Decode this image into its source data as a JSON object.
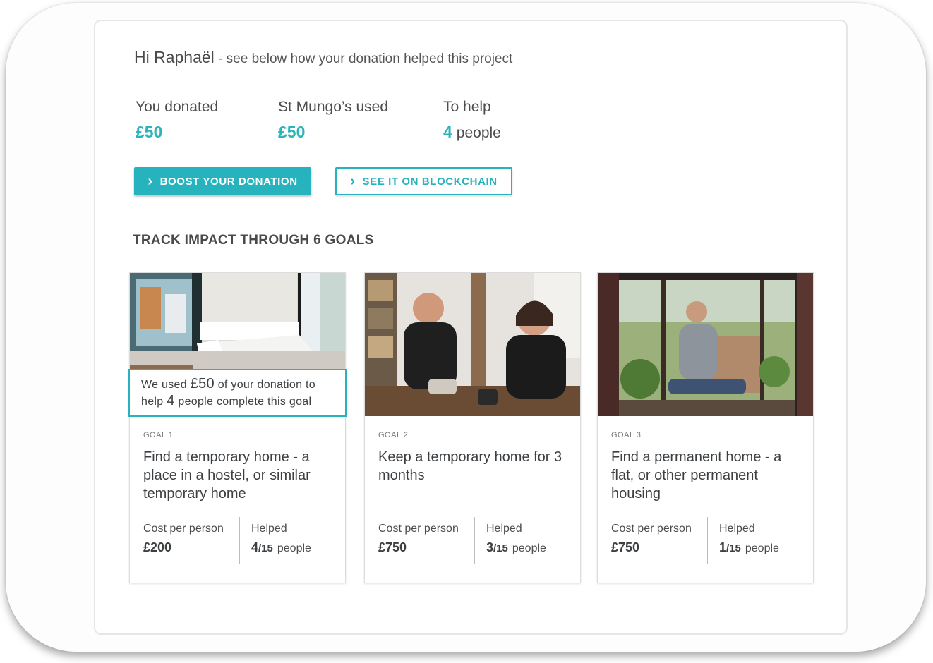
{
  "greeting": {
    "name": "Hi Raphaël",
    "message": "- see below how your donation helped this project"
  },
  "stats": {
    "donated": {
      "label": "You donated",
      "value": "£50"
    },
    "used": {
      "label": "St Mungo’s used",
      "value": "£50"
    },
    "help": {
      "label": "To help",
      "value": "4",
      "unit": "people"
    }
  },
  "buttons": {
    "boost": {
      "label": "BOOST YOUR DONATION",
      "icon": "chevron-right-icon"
    },
    "blockchain": {
      "label": "SEE IT ON BLOCKCHAIN",
      "icon": "chevron-right-icon"
    }
  },
  "section": {
    "title": "TRACK IMPACT THROUGH 6 GOALS"
  },
  "tooltip": {
    "p1": "We used",
    "amount": "£50",
    "p2": "of your donation to",
    "p3": "help",
    "count": "4",
    "p4": "people complete this goal"
  },
  "goals": [
    {
      "label": "GOAL 1",
      "title": "Find a temporary home - a place in a hostel, or similar temporary home",
      "cost_label": "Cost per person",
      "cost": "£200",
      "helped_label": "Helped",
      "helped": "4",
      "of": "/15",
      "people": "people",
      "photo": "hostel-room-photo"
    },
    {
      "label": "GOAL 2",
      "title": "Keep a temporary home for 3 months",
      "cost_label": "Cost per person",
      "cost": "£750",
      "helped_label": "Helped",
      "helped": "3",
      "of": "/15",
      "people": "people",
      "photo": "two-people-talking-photo"
    },
    {
      "label": "GOAL 3",
      "title": "Find a permanent home - a flat, or other permanent housing",
      "cost_label": "Cost per person",
      "cost": "£750",
      "helped_label": "Helped",
      "helped": "1",
      "of": "/15",
      "people": "people",
      "photo": "woman-at-window-photo"
    }
  ],
  "colors": {
    "accent": "#26b3bd",
    "text": "#3d4043"
  }
}
